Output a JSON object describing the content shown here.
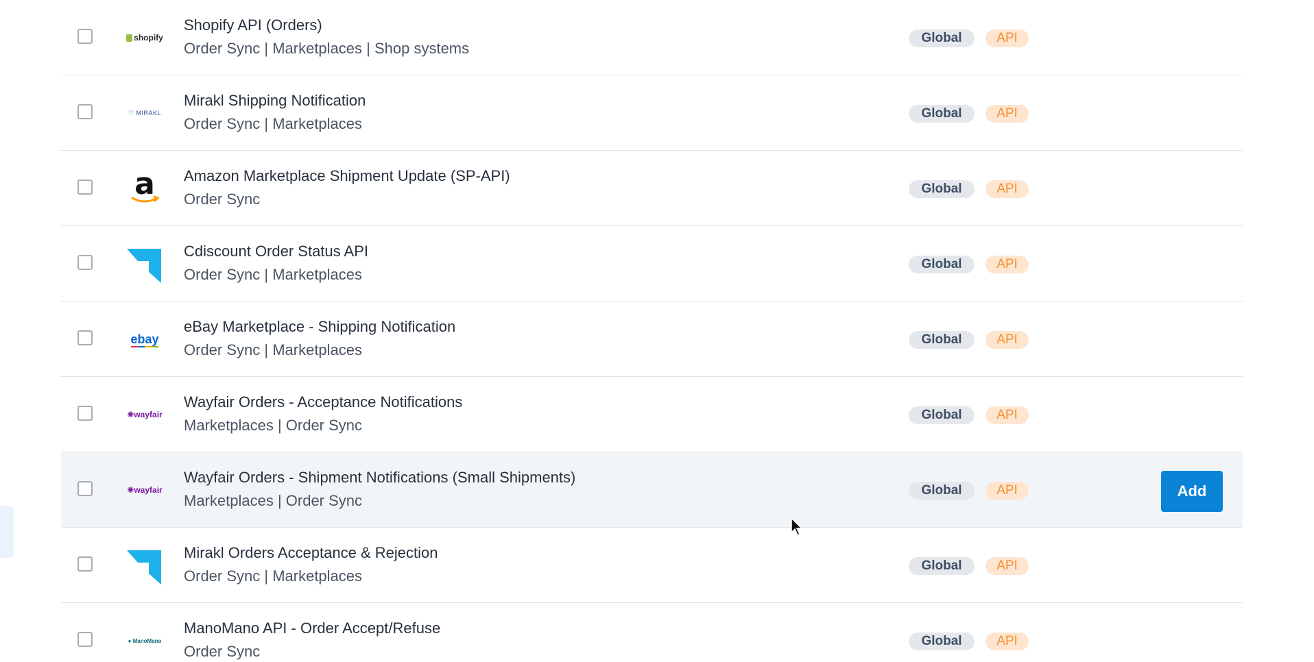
{
  "rows": [
    {
      "title": "Shopify API (Orders)",
      "categories": "Order Sync | Marketplaces | Shop systems",
      "scope": "Global",
      "type": "API",
      "logo": "shopify-logo",
      "logo_text": "shopify"
    },
    {
      "title": "Mirakl Shipping Notification",
      "categories": "Order Sync | Marketplaces",
      "scope": "Global",
      "type": "API",
      "logo": "mirakl-logo",
      "logo_text": "MIRAKL"
    },
    {
      "title": "Amazon Marketplace Shipment Update (SP-API)",
      "categories": "Order Sync",
      "scope": "Global",
      "type": "API",
      "logo": "amazon-logo",
      "logo_text": "a"
    },
    {
      "title": "Cdiscount Order Status API",
      "categories": "Order Sync | Marketplaces",
      "scope": "Global",
      "type": "API",
      "logo": "arrow-logo"
    },
    {
      "title": "eBay Marketplace - Shipping Notification",
      "categories": "Order Sync | Marketplaces",
      "scope": "Global",
      "type": "API",
      "logo": "ebay-logo",
      "logo_text": "ebay"
    },
    {
      "title": "Wayfair Orders - Acceptance Notifications",
      "categories": "Marketplaces | Order Sync",
      "scope": "Global",
      "type": "API",
      "logo": "wayfair-logo",
      "logo_text": "wayfair"
    },
    {
      "title": "Wayfair Orders - Shipment Notifications (Small Shipments)",
      "categories": "Marketplaces | Order Sync",
      "scope": "Global",
      "type": "API",
      "logo": "wayfair-logo",
      "logo_text": "wayfair"
    },
    {
      "title": "Mirakl Orders Acceptance & Rejection",
      "categories": "Order Sync | Marketplaces",
      "scope": "Global",
      "type": "API",
      "logo": "arrow-logo"
    },
    {
      "title": "ManoMano API - Order Accept/Refuse",
      "categories": "Order Sync",
      "scope": "Global",
      "type": "API",
      "logo": "manomano-logo",
      "logo_text": "ManoMano"
    }
  ],
  "add_label": "Add",
  "colors": {
    "accent": "#0b84d8",
    "api_badge_bg": "#fde5d0",
    "api_badge_text": "#f5902f",
    "global_badge_bg": "#e4e8ed",
    "arrow_logo": "#1fb1ec"
  }
}
